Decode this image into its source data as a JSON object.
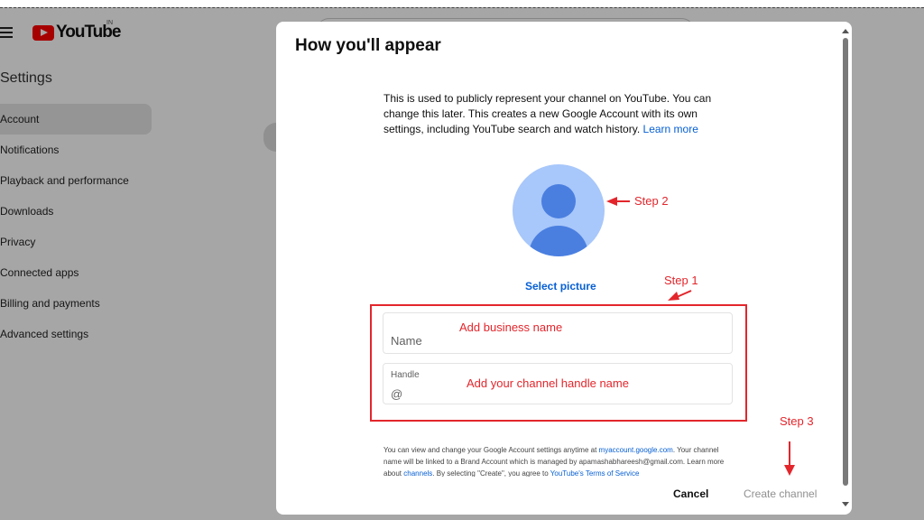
{
  "background": {
    "brand": "YouTube",
    "region": "IN",
    "settings_title": "Settings",
    "nav": [
      {
        "label": "Account",
        "active": true
      },
      {
        "label": "Notifications"
      },
      {
        "label": "Playback and performance"
      },
      {
        "label": "Downloads"
      },
      {
        "label": "Privacy"
      },
      {
        "label": "Connected apps"
      },
      {
        "label": "Billing and payments"
      },
      {
        "label": "Advanced settings"
      }
    ]
  },
  "dialog": {
    "title": "How you'll appear",
    "description": "This is used to publicly represent your channel on YouTube. You can change this later. This creates a new Google Account with its own settings, including YouTube search and watch history.",
    "learn_more": "Learn more",
    "select_picture": "Select picture",
    "name_placeholder": "Name",
    "handle_label": "Handle",
    "handle_prefix": "@",
    "footer_text_1": "You can view and change your Google Account settings anytime at",
    "footer_link_1": "myaccount.google.com",
    "footer_text_2": ". Your channel name will be linked to a Brand Account which is managed by apamashabhareesh@gmail.com. Learn more about",
    "footer_link_2": "channels",
    "footer_text_3": ". By selecting \"Create\", you agree to",
    "footer_link_3": "YouTube's Terms of Service",
    "cancel": "Cancel",
    "create": "Create channel"
  },
  "annotations": {
    "step1": "Step 1",
    "step2": "Step 2",
    "step3": "Step 3",
    "name_hint": "Add business name",
    "handle_hint": "Add your channel handle name"
  },
  "colors": {
    "annotation": "#e3262c",
    "link": "#065fd4",
    "youtube_red": "#ff0000",
    "avatar_bg": "#a8c7fa",
    "avatar_fg": "#4a7fe0"
  }
}
